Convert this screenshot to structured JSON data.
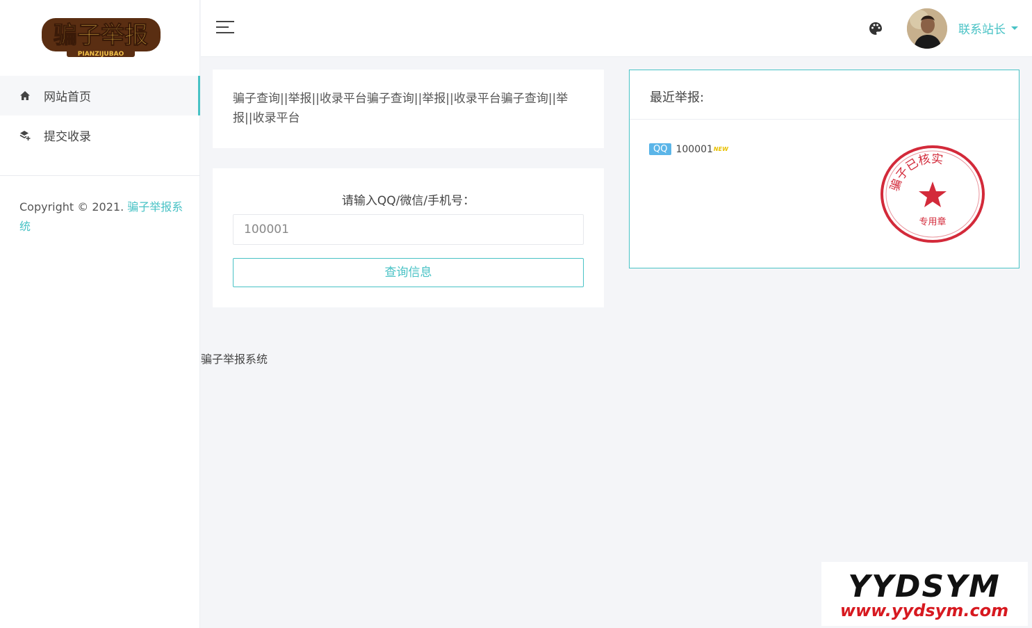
{
  "brand": {
    "logo_text": "骗子举报",
    "logo_sub": "PIANZIJUBAO"
  },
  "sidebar": {
    "items": [
      {
        "label": "网站首页",
        "icon": "home-icon",
        "active": true
      },
      {
        "label": "提交收录",
        "icon": "layers-plus-icon",
        "active": false
      }
    ],
    "copyright_prefix": "Copyright © 2021. ",
    "copyright_link": "骗子举报系统"
  },
  "header": {
    "user_name": "联系站长"
  },
  "description": "骗子查询||举报||收录平台骗子查询||举报||收录平台骗子查询||举报||收录平台",
  "query": {
    "label": "请输入QQ/微信/手机号：",
    "input_value": "100001",
    "button_label": "查询信息"
  },
  "recent": {
    "title": "最近举报:",
    "items": [
      {
        "badge": "QQ",
        "number": "100001",
        "new_tag": "NEW"
      }
    ],
    "stamp_text": "骗子已核实",
    "stamp_sub": "专用章"
  },
  "footer": {
    "text": "骗子举报系统"
  },
  "watermark": {
    "line1": "YYDSYM",
    "line2": "www.yydsym.com"
  },
  "colors": {
    "accent": "#48c2c5",
    "qq_badge": "#5bb5e8",
    "stamp": "#d32a3a",
    "watermark_red": "#d71920"
  }
}
